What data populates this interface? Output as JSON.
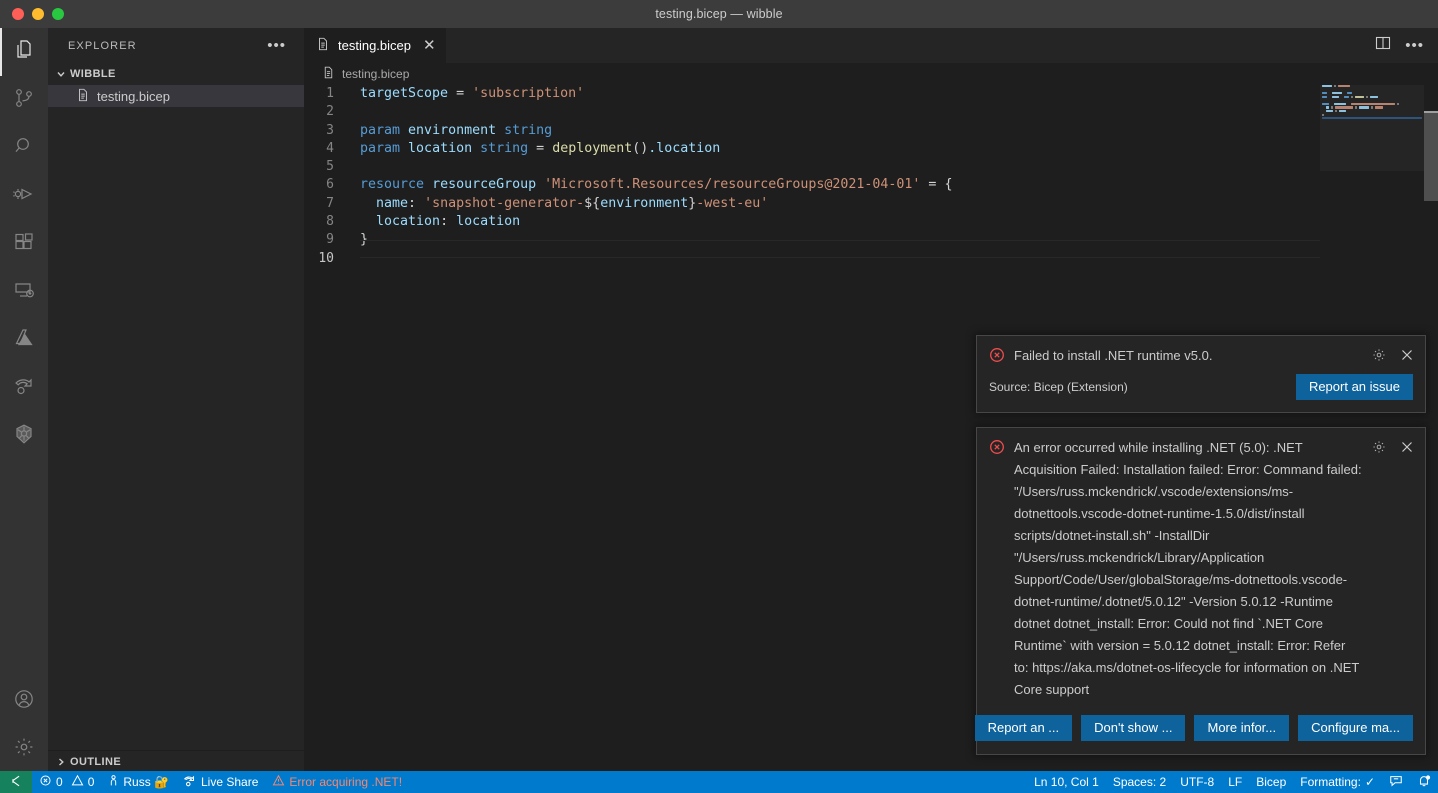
{
  "titlebar": {
    "title": "testing.bicep — wibble"
  },
  "activitybar": {
    "items": [
      {
        "name": "explorer",
        "icon": "files-icon",
        "active": true
      },
      {
        "name": "source-control",
        "icon": "source-control-icon",
        "active": false
      },
      {
        "name": "search",
        "icon": "search-icon",
        "active": false
      },
      {
        "name": "run-and-debug",
        "icon": "run-debug-icon",
        "active": false
      },
      {
        "name": "extensions",
        "icon": "extensions-icon",
        "active": false
      },
      {
        "name": "remote-explorer",
        "icon": "remote-explorer-icon",
        "active": false
      },
      {
        "name": "azure",
        "icon": "azure-icon",
        "active": false
      },
      {
        "name": "live-share",
        "icon": "live-share-icon",
        "active": false
      },
      {
        "name": "kubernetes",
        "icon": "kubernetes-icon",
        "active": false
      }
    ],
    "bottom": [
      {
        "name": "accounts",
        "icon": "account-icon"
      },
      {
        "name": "manage",
        "icon": "gear-icon"
      }
    ]
  },
  "sidebar": {
    "title": "EXPLORER",
    "more_label": "•••",
    "folder": {
      "label": "WIBBLE",
      "expanded": true
    },
    "files": [
      {
        "label": "testing.bicep",
        "selected": true
      }
    ],
    "outline": {
      "label": "OUTLINE",
      "expanded": false
    }
  },
  "editor": {
    "tab": {
      "label": "testing.bicep",
      "close_label": "✕"
    },
    "breadcrumb": "testing.bicep",
    "actions": [
      {
        "name": "split-editor-icon"
      },
      {
        "name": "more-actions-icon",
        "label": "•••"
      }
    ],
    "lines": [
      {
        "n": "1",
        "tokens": [
          {
            "t": "targetScope",
            "c": "k-id"
          },
          {
            "t": " = ",
            "c": "k-punc"
          },
          {
            "t": "'subscription'",
            "c": "k-str"
          }
        ]
      },
      {
        "n": "2",
        "tokens": []
      },
      {
        "n": "3",
        "tokens": [
          {
            "t": "param",
            "c": "k-decl"
          },
          {
            "t": " ",
            "c": "k-punc"
          },
          {
            "t": "environment",
            "c": "k-id"
          },
          {
            "t": " ",
            "c": "k-punc"
          },
          {
            "t": "string",
            "c": "k-type"
          }
        ]
      },
      {
        "n": "4",
        "tokens": [
          {
            "t": "param",
            "c": "k-decl"
          },
          {
            "t": " ",
            "c": "k-punc"
          },
          {
            "t": "location",
            "c": "k-id"
          },
          {
            "t": " ",
            "c": "k-punc"
          },
          {
            "t": "string",
            "c": "k-type"
          },
          {
            "t": " = ",
            "c": "k-punc"
          },
          {
            "t": "deployment",
            "c": "k-fn"
          },
          {
            "t": "()",
            "c": "k-punc"
          },
          {
            "t": ".location",
            "c": "k-id"
          }
        ]
      },
      {
        "n": "5",
        "tokens": []
      },
      {
        "n": "6",
        "tokens": [
          {
            "t": "resource",
            "c": "k-decl"
          },
          {
            "t": " ",
            "c": "k-punc"
          },
          {
            "t": "resourceGroup",
            "c": "k-id"
          },
          {
            "t": " ",
            "c": "k-punc"
          },
          {
            "t": "'Microsoft.Resources/resourceGroups@2021-04-01'",
            "c": "k-str"
          },
          {
            "t": " = {",
            "c": "k-punc"
          }
        ]
      },
      {
        "n": "7",
        "tokens": [
          {
            "t": "  ",
            "c": "k-punc"
          },
          {
            "t": "name",
            "c": "k-prop"
          },
          {
            "t": ": ",
            "c": "k-punc"
          },
          {
            "t": "'snapshot-generator-",
            "c": "k-str"
          },
          {
            "t": "${",
            "c": "k-punc"
          },
          {
            "t": "environment",
            "c": "k-id"
          },
          {
            "t": "}",
            "c": "k-punc"
          },
          {
            "t": "-west-eu'",
            "c": "k-str"
          }
        ]
      },
      {
        "n": "8",
        "tokens": [
          {
            "t": "  ",
            "c": "k-punc"
          },
          {
            "t": "location",
            "c": "k-prop"
          },
          {
            "t": ": ",
            "c": "k-punc"
          },
          {
            "t": "location",
            "c": "k-id"
          }
        ]
      },
      {
        "n": "9",
        "tokens": [
          {
            "t": "}",
            "c": "k-punc"
          }
        ]
      },
      {
        "n": "10",
        "tokens": [],
        "current": true
      }
    ]
  },
  "notifications": [
    {
      "name": "dotnet-install-failed",
      "severity": "error",
      "message": "Failed to install .NET runtime v5.0.",
      "source": "Source: Bicep (Extension)",
      "buttons": [
        {
          "label": "Report an issue"
        }
      ],
      "icons": [
        {
          "name": "gear-icon"
        },
        {
          "name": "close-icon",
          "label": "✕"
        }
      ]
    },
    {
      "name": "dotnet-acquisition-error",
      "severity": "error",
      "message": "An error occurred while installing .NET (5.0): .NET Acquisition Failed: Installation failed: Error: Command failed: \"/Users/russ.mckendrick/.vscode/extensions/ms-dotnettools.vscode-dotnet-runtime-1.5.0/dist/install scripts/dotnet-install.sh\" -InstallDir \"/Users/russ.mckendrick/Library/Application Support/Code/User/globalStorage/ms-dotnettools.vscode-dotnet-runtime/.dotnet/5.0.12\" -Version 5.0.12 -Runtime dotnet dotnet_install: Error: Could not find `.NET Core Runtime` with version = 5.0.12 dotnet_install: Error: Refer to: https://aka.ms/dotnet-os-lifecycle for information on .NET Core support",
      "buttons": [
        {
          "label": "Report an ..."
        },
        {
          "label": "Don't show ..."
        },
        {
          "label": "More infor..."
        },
        {
          "label": "Configure ma..."
        }
      ],
      "icons": [
        {
          "name": "gear-icon"
        },
        {
          "name": "close-icon",
          "label": "✕"
        }
      ]
    }
  ],
  "statusbar": {
    "remote": {
      "name": "remote-host-icon"
    },
    "left": [
      {
        "name": "problems",
        "icon": "error-icon",
        "errors": "0",
        "warn_icon": "warning-icon",
        "warnings": "0"
      },
      {
        "name": "live-share-user",
        "icon": "person-icon",
        "label": "Russ 🔐"
      },
      {
        "name": "live-share",
        "icon": "broadcast-icon",
        "label": "Live Share"
      },
      {
        "name": "dotnet-error",
        "icon": "alert-icon",
        "label": "Error acquiring .NET!"
      }
    ],
    "right": [
      {
        "name": "cursor-position",
        "label": "Ln 10, Col 1"
      },
      {
        "name": "indentation",
        "label": "Spaces: 2"
      },
      {
        "name": "encoding",
        "label": "UTF-8"
      },
      {
        "name": "eol",
        "label": "LF"
      },
      {
        "name": "language-mode",
        "label": "Bicep"
      },
      {
        "name": "formatting",
        "label": "Formatting:",
        "check": "✓"
      },
      {
        "name": "feedback-icon"
      },
      {
        "name": "notifications-bell-icon"
      }
    ]
  },
  "colors": {
    "accent": "#007acc",
    "button": "#0e639c",
    "error": "#f14c4c",
    "remote": "#16825d",
    "editor_bg": "#1e1e1e",
    "sidebar_bg": "#252526",
    "activitybar_bg": "#333333"
  }
}
